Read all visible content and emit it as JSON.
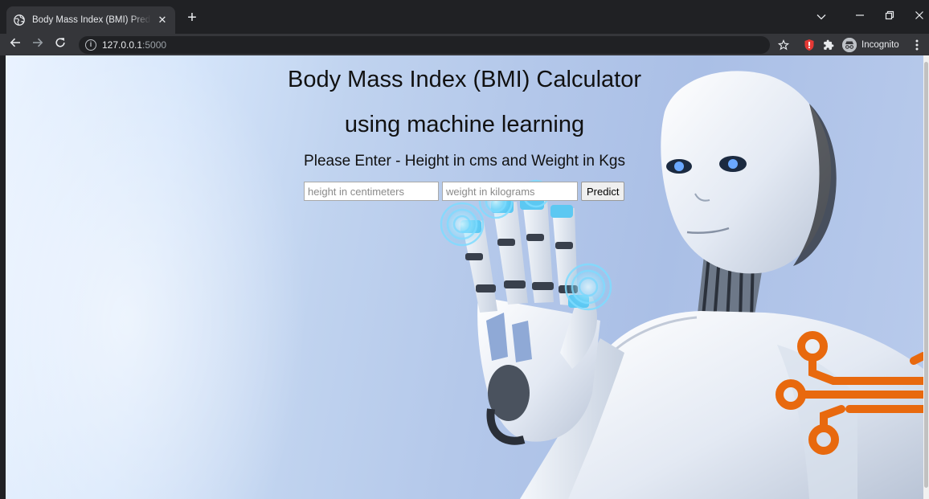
{
  "browser": {
    "tab_title": "Body Mass Index (BMI) Prediction",
    "tab_close": "✕",
    "new_tab": "+",
    "url_host": "127.0.0.1",
    "url_port": ":5000",
    "incognito_label": "Incognito"
  },
  "page": {
    "title_line1": "Body Mass Index (BMI) Calculator",
    "title_line2": "using machine learning",
    "instruction": "Please Enter - Height in cms and Weight in Kgs",
    "height_placeholder": "height in centimeters",
    "weight_placeholder": "weight in kilograms",
    "height_value": "",
    "weight_value": "",
    "predict_label": "Predict"
  },
  "colors": {
    "chrome_dark": "#202124",
    "chrome_toolbar": "#35363a",
    "accent_orange": "#e8690e"
  }
}
